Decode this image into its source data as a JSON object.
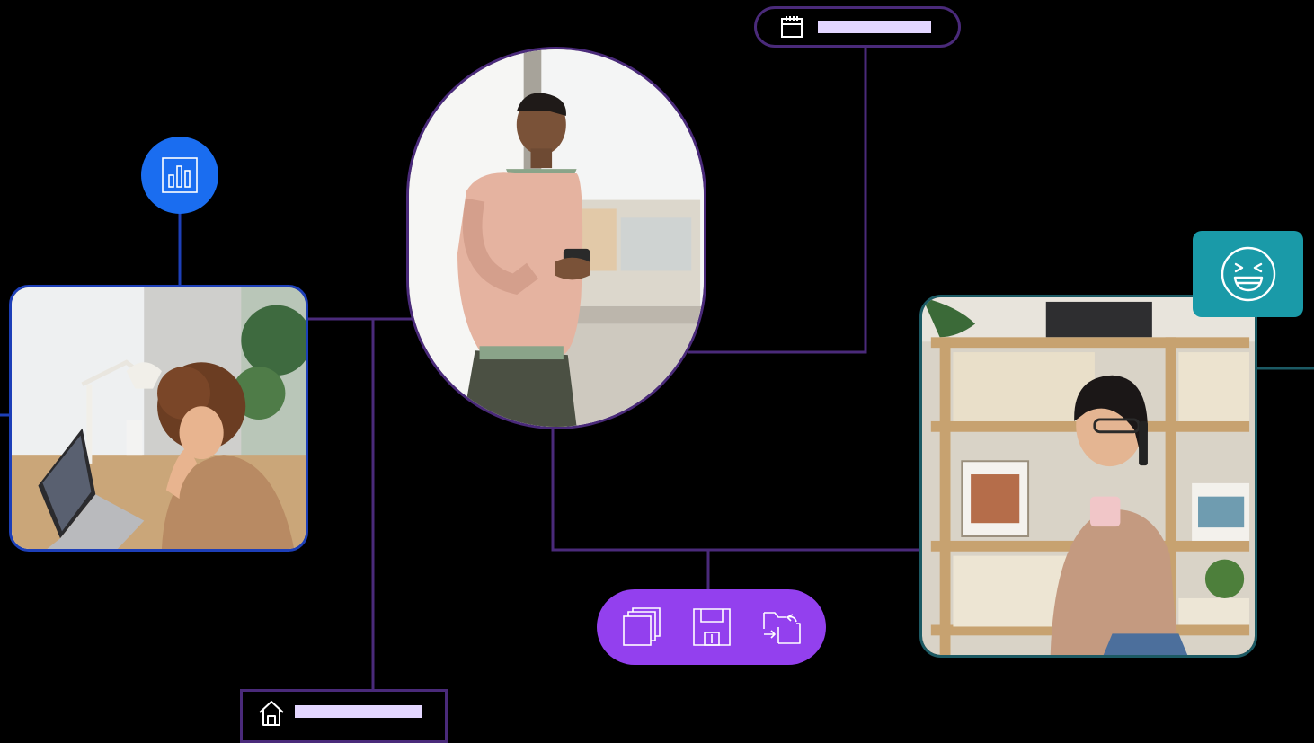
{
  "theme": {
    "background": "#000000",
    "connector_purple": "#4a2a7a",
    "connector_blue": "#1d3fb8",
    "connector_teal": "#1c5a64",
    "chart_badge_color": "#1a6df0",
    "emoji_badge_color": "#1a9aa8",
    "toolbar_color": "#9340ee",
    "placeholder_color": "#e3d6ff"
  },
  "photos": [
    {
      "name": "woman-video-call-at-laptop",
      "frame": "rounded-rectangle",
      "border_color": "#1d3fb8"
    },
    {
      "name": "man-using-smartphone-by-window",
      "frame": "oval",
      "border_color": "#4a2a7a"
    },
    {
      "name": "woman-on-phone-holding-mug",
      "frame": "rounded-rectangle",
      "border_color": "#1c5a64"
    }
  ],
  "badges": {
    "chart": {
      "icon": "bar-chart-icon",
      "shape": "circle"
    },
    "emoji": {
      "icon": "laughing-face-icon",
      "shape": "rounded-square"
    }
  },
  "calendar_pill": {
    "icon": "calendar-icon",
    "text_placeholder": true
  },
  "home_tag": {
    "icon": "home-icon",
    "text_placeholder": true
  },
  "toolbar": {
    "items": [
      {
        "icon": "copy-pages-icon"
      },
      {
        "icon": "save-disk-icon"
      },
      {
        "icon": "folder-sync-icon"
      }
    ]
  }
}
